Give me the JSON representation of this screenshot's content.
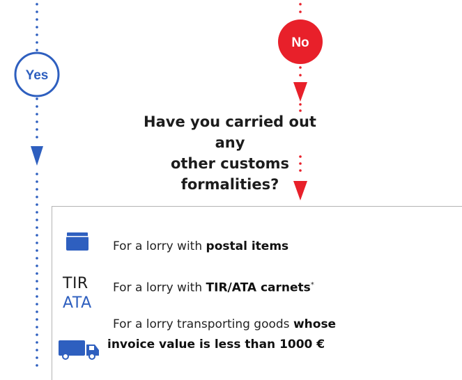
{
  "branches": {
    "yes_label": "Yes",
    "no_label": "No"
  },
  "question": {
    "line1": "Have you carried out any",
    "line2": "other customs formalities?"
  },
  "options": [
    {
      "prefix": "For a lorry with ",
      "bold": "postal items",
      "icon": "parcel-box-icon"
    },
    {
      "prefix": "For a lorry with ",
      "bold": "TIR/ATA carnets",
      "suffix": "*",
      "icon": "tir-ata-icon",
      "icon_line1": "TIR",
      "icon_line2": "ATA"
    },
    {
      "line1_prefix": "For a lorry transporting goods ",
      "line1_bold": "whose",
      "line2_bold": "invoice value is less than 1000 €",
      "icon": "truck-icon"
    }
  ],
  "colors": {
    "blue": "#2e5fbf",
    "red": "#e8202a",
    "text": "#1c1c1c",
    "border": "#b3b3b3"
  }
}
